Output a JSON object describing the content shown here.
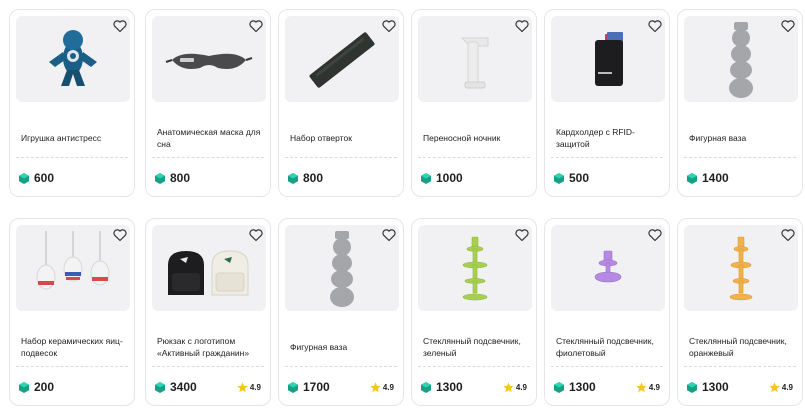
{
  "products": [
    {
      "title": "Игрушка антистресс",
      "price": "600",
      "rating": ""
    },
    {
      "title": "Анатомическая маска для сна",
      "price": "800",
      "rating": ""
    },
    {
      "title": "Набор отверток",
      "price": "800",
      "rating": ""
    },
    {
      "title": "Переносной ночник",
      "price": "1000",
      "rating": ""
    },
    {
      "title": "Кардхолдер с RFID-защитой",
      "price": "500",
      "rating": ""
    },
    {
      "title": "Фигурная ваза",
      "price": "1400",
      "rating": ""
    },
    {
      "title": "Набор керамических яиц-подвесок",
      "price": "200",
      "rating": ""
    },
    {
      "title": "Рюкзак с логотипом «Активный гражданин»",
      "price": "3400",
      "rating": "4.9"
    },
    {
      "title": "Фигурная ваза",
      "price": "1700",
      "rating": "4.9"
    },
    {
      "title": "Стеклянный подсвечник, зеленый",
      "price": "1300",
      "rating": "4.9"
    },
    {
      "title": "Стеклянный подсвечник, фиолетовый",
      "price": "1300",
      "rating": "4.9"
    },
    {
      "title": "Стеклянный подсвечник, оранжевый",
      "price": "1300",
      "rating": "4.9"
    }
  ],
  "colors": {
    "coin": "#16a085",
    "star": "#f5c518",
    "border": "#e6e6e6"
  }
}
